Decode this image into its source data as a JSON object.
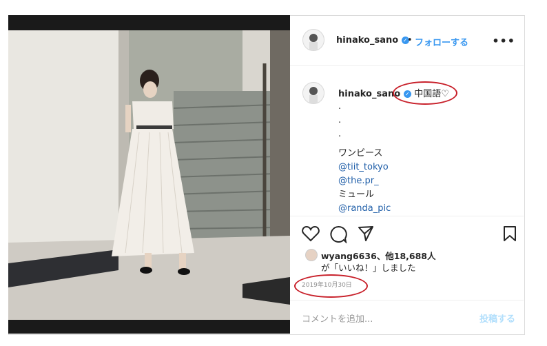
{
  "post": {
    "username": "hinako_sano",
    "header_separator": "•",
    "follow_label": "フォローする",
    "more_label": "•••",
    "caption": {
      "username": "hinako_sano",
      "text": "中国語♡",
      "dots": [
        ".",
        ".",
        "."
      ],
      "label_onepiece": "ワンピース",
      "tag_1": "@tiit_tokyo",
      "tag_2": "@the.pr_",
      "label_mule": "ミュール",
      "tag_3": "@randa_pic"
    },
    "likes": {
      "line1": "wyang6636、他18,688人",
      "line2": "が「いいね！」しました"
    },
    "date": "2019年10月30日",
    "comment_placeholder": "コメントを追加...",
    "post_button": "投稿する"
  },
  "icons": [
    "heart-icon",
    "comment-icon",
    "share-icon",
    "bookmark-icon",
    "verified-badge-icon"
  ],
  "colors": {
    "accent": "#3897f0",
    "highlight_ring": "#c8202a",
    "text": "#262626",
    "muted": "#8e8e8e"
  }
}
